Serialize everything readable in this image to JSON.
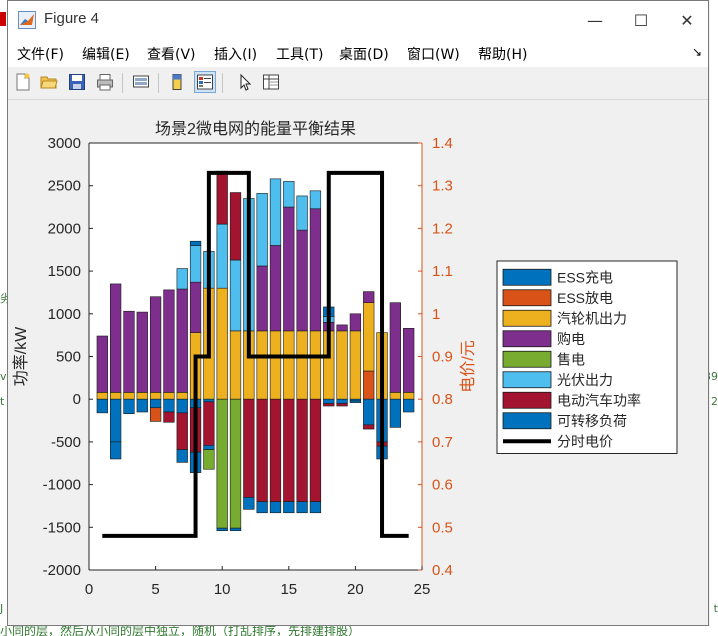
{
  "window": {
    "title": "Figure 4",
    "controls": {
      "minimize": "—",
      "maximize": "☐",
      "close": "✕"
    }
  },
  "menu": {
    "items": [
      "文件(F)",
      "编辑(E)",
      "查看(V)",
      "插入(I)",
      "工具(T)",
      "桌面(D)",
      "窗口(W)",
      "帮助(H)"
    ],
    "dock_arrow": "↘"
  },
  "toolbar": {
    "buttons": [
      "new-figure-icon",
      "open-folder-icon",
      "save-icon",
      "print-icon",
      "link-plot-icon",
      "colorbar-icon",
      "legend-icon",
      "pointer-icon",
      "property-inspector-icon"
    ]
  },
  "background_fragments": {
    "left": [
      "劣",
      "ve",
      "t",
      "J"
    ],
    "right": [
      "39",
      "2",
      "t"
    ],
    "bottom": "小同的层，然后从小同的层中独立，随机（打乱排序，先排建排股）"
  },
  "colors": {
    "ess_charge": "#0072bd",
    "ess_discharge": "#d95319",
    "turbine": "#edb120",
    "buy": "#7e2f8e",
    "sell": "#77ac30",
    "pv": "#4dbeee",
    "ev": "#a2142f",
    "shiftable": "#0072bd",
    "price": "#000000",
    "right_axis": "#d95319"
  },
  "chart_data": {
    "type": "bar",
    "stacked": true,
    "title": "场景2微电网的能量平衡结果",
    "xlabel": "",
    "ylabel": "功率/kW",
    "ylabel_right": "电价/元",
    "xlim": [
      0,
      25
    ],
    "ylim": [
      -2000,
      3000
    ],
    "ylim_right": [
      0.4,
      1.4
    ],
    "xticks": [
      0,
      5,
      10,
      15,
      20,
      25
    ],
    "yticks": [
      -2000,
      -1500,
      -1000,
      -500,
      0,
      500,
      1000,
      1500,
      2000,
      2500,
      3000
    ],
    "yticks_right": [
      0.4,
      0.5,
      0.6,
      0.7,
      0.8,
      0.9,
      1,
      1.1,
      1.2,
      1.3,
      1.4
    ],
    "x": [
      1,
      2,
      3,
      4,
      5,
      6,
      7,
      8,
      9,
      10,
      11,
      12,
      13,
      14,
      15,
      16,
      17,
      18,
      19,
      20,
      21,
      22,
      23,
      24
    ],
    "positive_series": [
      {
        "name": "ESS放电",
        "values": [
          0,
          0,
          0,
          0,
          0,
          0,
          0,
          0,
          0,
          0,
          0,
          0,
          0,
          0,
          0,
          0,
          0,
          0,
          0,
          0,
          330,
          0,
          0,
          0
        ]
      },
      {
        "name": "汽轮机出力",
        "values": [
          80,
          80,
          80,
          80,
          80,
          80,
          80,
          780,
          1300,
          1300,
          800,
          800,
          800,
          800,
          800,
          800,
          800,
          800,
          800,
          800,
          800,
          780,
          80,
          80
        ]
      },
      {
        "name": "购电",
        "values": [
          660,
          1270,
          950,
          940,
          1120,
          1200,
          1210,
          590,
          0,
          0,
          0,
          0,
          760,
          1000,
          1450,
          1180,
          1430,
          100,
          70,
          200,
          130,
          0,
          1050,
          750
        ]
      },
      {
        "name": "光伏出力",
        "values": [
          0,
          0,
          0,
          0,
          0,
          0,
          240,
          430,
          430,
          750,
          830,
          1550,
          850,
          780,
          300,
          400,
          210,
          70,
          0,
          0,
          0,
          0,
          0,
          0
        ]
      },
      {
        "name": "ESS充电",
        "values": [
          0,
          0,
          0,
          0,
          0,
          0,
          0,
          50,
          0,
          0,
          0,
          0,
          0,
          0,
          0,
          0,
          0,
          110,
          0,
          0,
          0,
          0,
          0,
          0
        ]
      },
      {
        "name": "电动汽车功率",
        "values": [
          0,
          0,
          0,
          0,
          0,
          0,
          0,
          0,
          0,
          620,
          790,
          0,
          0,
          0,
          0,
          0,
          0,
          0,
          0,
          0,
          0,
          0,
          0,
          0
        ]
      }
    ],
    "negative_series": [
      {
        "name": "可转移负荷",
        "values": [
          -160,
          -500,
          -170,
          -150,
          -100,
          -150,
          -160,
          -100,
          -30,
          0,
          0,
          0,
          0,
          0,
          0,
          0,
          0,
          -50,
          -50,
          -20,
          -300,
          -500,
          -330,
          -150
        ]
      },
      {
        "name": "ESS放电",
        "values": [
          0,
          0,
          0,
          0,
          -160,
          0,
          0,
          0,
          0,
          0,
          0,
          0,
          0,
          0,
          0,
          0,
          0,
          0,
          0,
          0,
          0,
          0,
          0,
          0
        ]
      },
      {
        "name": "电动汽车功率",
        "values": [
          0,
          0,
          0,
          0,
          0,
          -120,
          -430,
          -520,
          -510,
          0,
          0,
          -1150,
          -1200,
          -1200,
          -1200,
          -1200,
          -1200,
          -30,
          -30,
          0,
          -50,
          -50,
          0,
          0
        ]
      },
      {
        "name": "ESS充电",
        "values": [
          0,
          -200,
          0,
          0,
          0,
          0,
          -150,
          -240,
          -50,
          0,
          0,
          -140,
          -130,
          -130,
          -130,
          -130,
          -130,
          0,
          0,
          -20,
          0,
          -150,
          0,
          0
        ]
      },
      {
        "name": "售电",
        "values": [
          0,
          0,
          0,
          0,
          0,
          0,
          0,
          0,
          -230,
          -1510,
          -1510,
          0,
          0,
          0,
          0,
          0,
          0,
          0,
          0,
          0,
          0,
          0,
          0,
          0
        ]
      },
      {
        "name": "可转移负荷",
        "values": [
          0,
          0,
          0,
          0,
          0,
          0,
          0,
          0,
          0,
          -30,
          -30,
          0,
          0,
          0,
          0,
          0,
          0,
          0,
          0,
          0,
          0,
          0,
          0,
          0
        ]
      }
    ],
    "price_line": {
      "name": "分时电价",
      "x": [
        1,
        8,
        8,
        9,
        9,
        12,
        12,
        18,
        18,
        22,
        22,
        24
      ],
      "y": [
        0.48,
        0.48,
        0.9,
        0.9,
        1.33,
        1.33,
        0.9,
        0.9,
        1.33,
        1.33,
        0.48,
        0.48
      ]
    },
    "legend": {
      "position": "right",
      "entries": [
        {
          "label": "ESS充电",
          "color": "#0072bd",
          "kind": "patch"
        },
        {
          "label": "ESS放电",
          "color": "#d95319",
          "kind": "patch"
        },
        {
          "label": "汽轮机出力",
          "color": "#edb120",
          "kind": "patch"
        },
        {
          "label": "购电",
          "color": "#7e2f8e",
          "kind": "patch"
        },
        {
          "label": "售电",
          "color": "#77ac30",
          "kind": "patch"
        },
        {
          "label": "光伏出力",
          "color": "#4dbeee",
          "kind": "patch"
        },
        {
          "label": "电动汽车功率",
          "color": "#a2142f",
          "kind": "patch"
        },
        {
          "label": "可转移负荷",
          "color": "#0072bd",
          "kind": "patch"
        },
        {
          "label": "分时电价",
          "color": "#000000",
          "kind": "line"
        }
      ]
    }
  }
}
